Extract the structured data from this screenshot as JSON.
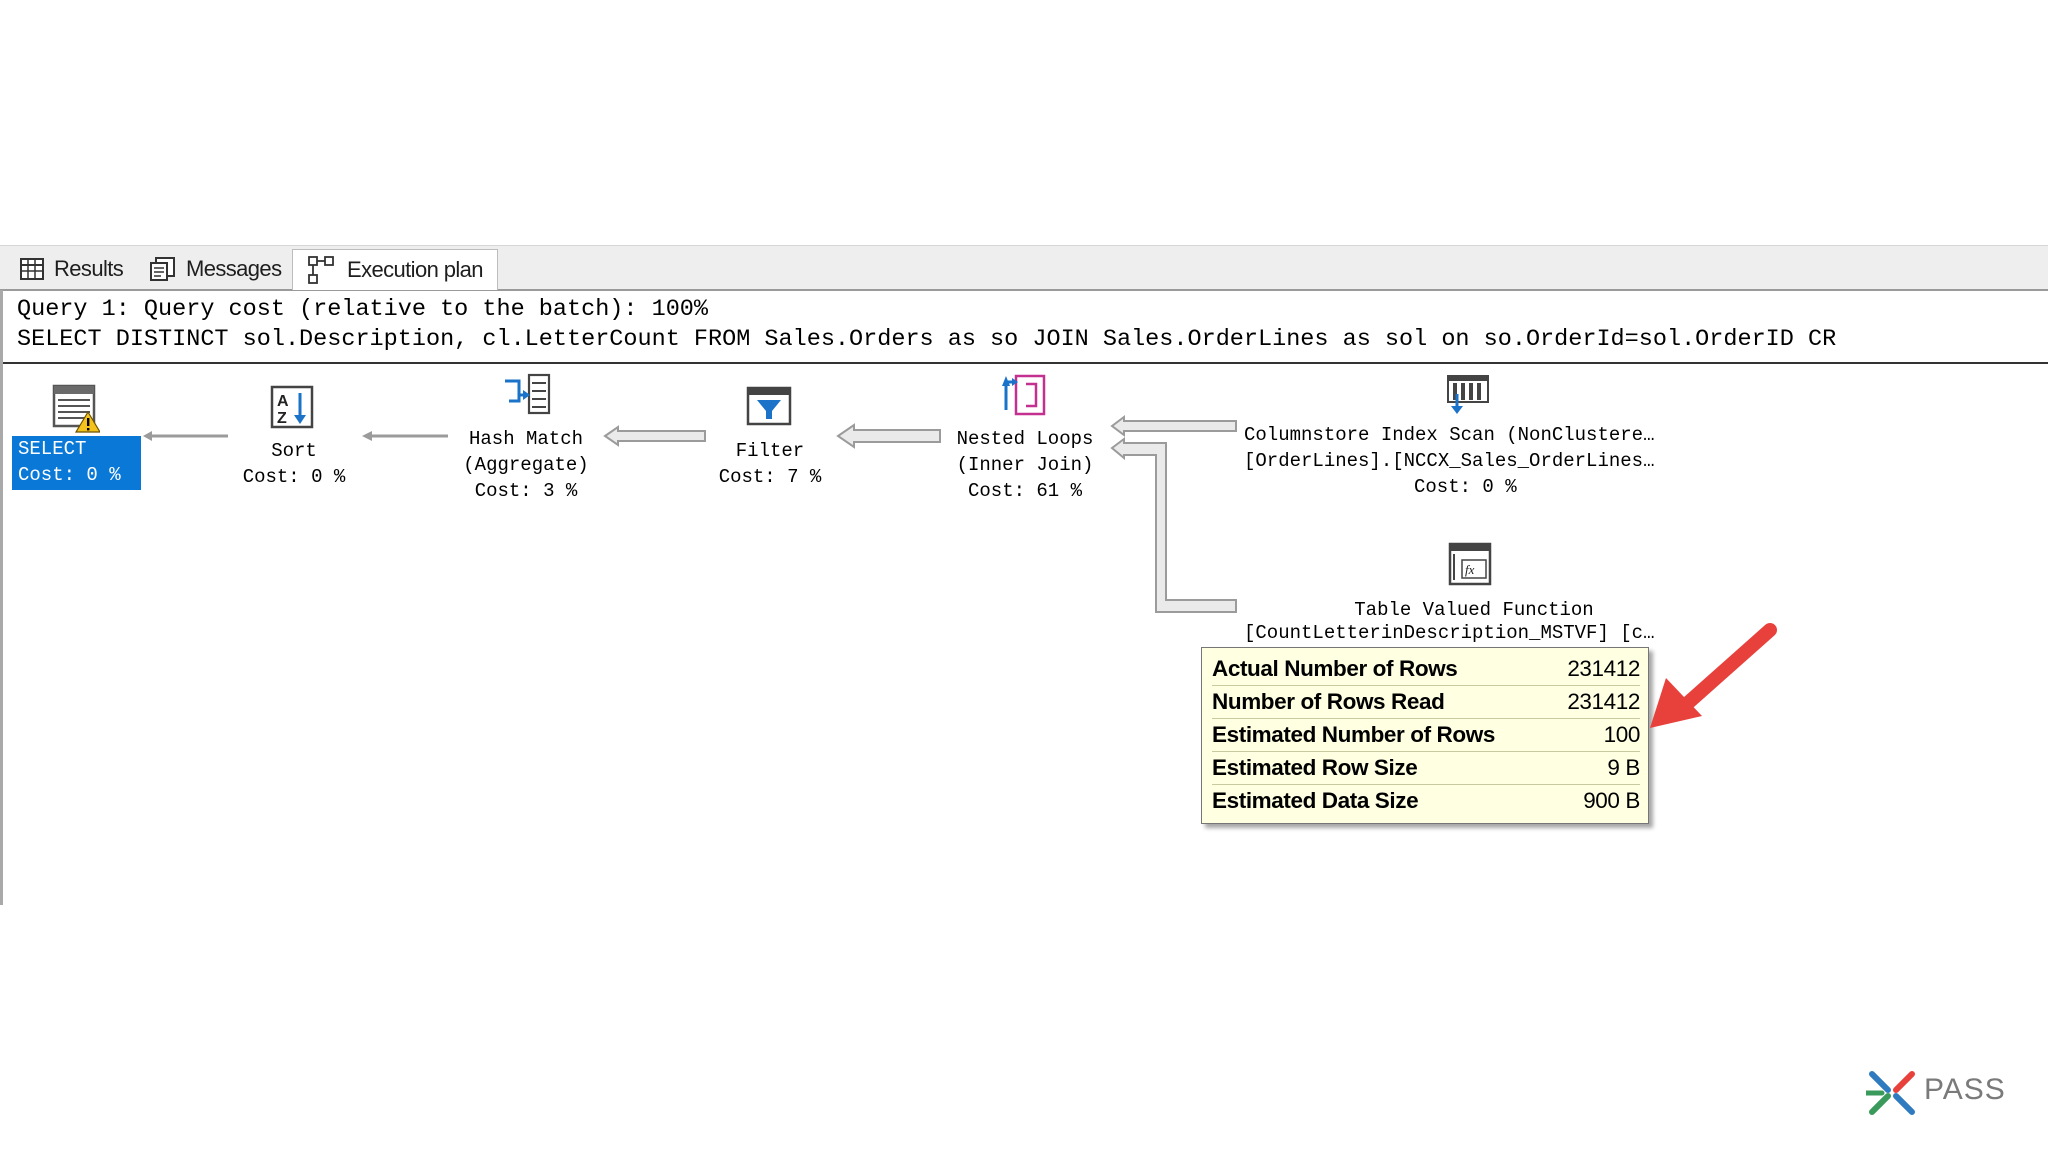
{
  "tabs": [
    {
      "label": "Results",
      "icon": "grid-icon",
      "active": false
    },
    {
      "label": "Messages",
      "icon": "messages-icon",
      "active": false
    },
    {
      "label": "Execution plan",
      "icon": "plan-icon",
      "active": true
    }
  ],
  "query": {
    "header": "Query 1: Query cost (relative to the batch): 100%",
    "sql": "SELECT DISTINCT sol.Description, cl.LetterCount FROM Sales.Orders as so JOIN Sales.OrderLines as sol on so.OrderId=sol.OrderID CR"
  },
  "operators": {
    "select": {
      "line1": "SELECT",
      "line2": "Cost: 0 %",
      "icon": "select-warning-icon"
    },
    "sort": {
      "line1": "Sort",
      "line2": "Cost: 0 %",
      "icon": "sort-icon"
    },
    "hash_match": {
      "line1": "Hash Match",
      "line2": "(Aggregate)",
      "line3": "Cost: 3 %",
      "icon": "hash-match-icon"
    },
    "filter": {
      "line1": "Filter",
      "line2": "Cost: 7 %",
      "icon": "filter-icon"
    },
    "nested_loops": {
      "line1": "Nested Loops",
      "line2": "(Inner Join)",
      "line3": "Cost: 61 %",
      "icon": "nested-loops-icon"
    },
    "columnstore": {
      "line1": "Columnstore Index Scan (NonClustere…",
      "line2": "[OrderLines].[NCCX_Sales_OrderLines…",
      "line3": "Cost: 0 %",
      "icon": "columnstore-scan-icon"
    },
    "tvf": {
      "line1": "Table Valued Function",
      "line2": "[CountLetterinDescription_MSTVF] [c…",
      "icon": "table-valued-function-icon"
    }
  },
  "tooltip": {
    "rows": [
      {
        "label": "Actual Number of Rows",
        "value": "231412"
      },
      {
        "label": "Number of Rows Read",
        "value": "231412"
      },
      {
        "label": "Estimated Number of Rows",
        "value": "100"
      },
      {
        "label": "Estimated Row Size",
        "value": "9 B"
      },
      {
        "label": "Estimated Data Size",
        "value": "900 B"
      }
    ]
  },
  "annotation": {
    "icon": "red-arrow-icon",
    "color": "#e8413c"
  },
  "logo": {
    "text": "PASS",
    "icon": "pass-logo-icon"
  },
  "colors": {
    "select_highlight": "#0a78d7",
    "tooltip_bg": "#ffffe1",
    "arrow": "#e8413c"
  }
}
